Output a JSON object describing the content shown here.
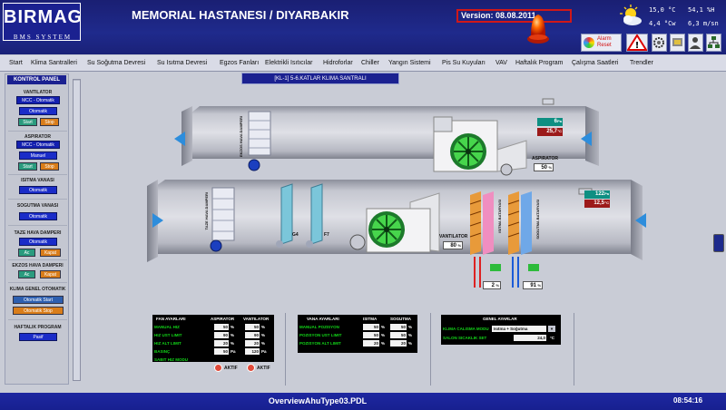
{
  "header": {
    "logo_text": "BIRMAG",
    "logo_sub": "BMS SYSTEM",
    "title": "MEMORIAL HASTANESI / DIYARBAKIR",
    "version": "Version: 08.08.2011",
    "alarm_reset": "Alarm Reset",
    "weather": {
      "temp": "15,0 °C",
      "hum": "54,1 %H",
      "enthalpy": "4,4 °Cw",
      "wind": "6,3 m/sn"
    }
  },
  "menu": [
    "Start",
    "Klima Santralleri",
    "Su Soğutma Devresi",
    "Su Isıtma Devresi",
    "Egzos Fanları",
    "Elektrikli Isıtıcılar",
    "Hidroforlar",
    "Chiller",
    "Yangın Sistemi",
    "Pis Su Kuyuları",
    "VAV",
    "Haftalık Program",
    "Çalışma Saatleri",
    "Trendler"
  ],
  "panel": {
    "title": "KONTROL PANEL",
    "vantilator_title": "VANTILATOR",
    "vantilator_mode": "MCC - Otomatik",
    "vantilator_state": "Otomatik",
    "aspirator_title": "ASPIRATOR",
    "aspirator_mode": "MCC - Otomatik",
    "aspirator_state": "Manuel",
    "start": "Start",
    "stop": "Stop",
    "isitma_title": "ISITMA VANASI",
    "isitma_state": "Otomatik",
    "sogutma_title": "SOGUTMA VANASI",
    "sogutma_state": "Otomatik",
    "taze_title": "TAZE HAVA DAMPERI",
    "taze_state": "Otomatik",
    "egzos_title": "EKZOS HAVA DAMPERI",
    "ac": "Ac",
    "kapat": "Kapat",
    "klima_title": "KLIMA GENEL OTOMATIK",
    "klima_start": "Otomatik Start",
    "klima_stop": "Otomatik Stop",
    "haftalik_title": "HAFTALIK PROGRAM",
    "haftalik_state": "Pasif"
  },
  "sheet_title": "[KL-1] 5-6.KATLAR KLIMA SANTRALI",
  "diagram": {
    "upper_pressure": "6",
    "upper_pressure_unit": "Pa",
    "upper_temp": "25,7",
    "upper_temp_unit": "°C",
    "aspirator_label": "ASPIRATOR",
    "aspirator_speed": "50",
    "aspirator_unit": "%",
    "lower_pressure": "122",
    "lower_pressure_unit": "Pa",
    "lower_temp": "12,5",
    "lower_temp_unit": "°C",
    "vantilator_label": "VANTILATOR",
    "vantilator_speed": "80",
    "vantilator_unit": "%",
    "heating_valve": "2",
    "cooling_valve": "91",
    "valve_unit": "%",
    "filter1": "G4",
    "filter2": "F7",
    "exhaust_damper_label": "EKZOS HAVA DAMPERI",
    "fresh_damper_label": "TAZE HAVA DAMPERI",
    "heating_coil_label": "ISITMA BATARYASI",
    "cooling_coil_label": "SOGUTMA BATARYASI"
  },
  "fan_table": {
    "headers": [
      "FAN AYARLARI",
      "ASPIRATOR",
      "VANTILATOR"
    ],
    "rows": [
      {
        "label": "MANUAL HIZ",
        "a": "50",
        "au": "%",
        "v": "50",
        "vu": "%"
      },
      {
        "label": "HIZ UST LIMIT",
        "a": "90",
        "au": "%",
        "v": "90",
        "vu": "%"
      },
      {
        "label": "HIZ ALT LIMIT",
        "a": "20",
        "au": "%",
        "v": "20",
        "vu": "%"
      },
      {
        "label": "BASINÇ",
        "a": "50",
        "au": "Pa",
        "v": "120",
        "vu": "Pa"
      }
    ],
    "sabit_label": "SABIT HIZ MODU",
    "aktif1": "AKTIF",
    "aktif2": "AKTIF"
  },
  "valve_table": {
    "headers": [
      "VANA AYARLARI",
      "ISITMA",
      "SOGUTMA"
    ],
    "rows": [
      {
        "label": "MANUAL POZISYON",
        "i": "50",
        "iu": "%",
        "s": "50",
        "su": "%"
      },
      {
        "label": "POZISYON UST LIMIT",
        "i": "50",
        "iu": "%",
        "s": "50",
        "su": "%"
      },
      {
        "label": "POZISYON ALT LIMIT",
        "i": "20",
        "iu": "%",
        "s": "20",
        "su": "%"
      }
    ]
  },
  "general_table": {
    "header": "GENEL AYARLAR",
    "mode_label": "KLIMA CALISMA MODU",
    "mode_value": "Isıtma + Soğutma",
    "setpoint_label": "SALON SICAKLIK SET",
    "setpoint_value": "24,0",
    "setpoint_unit": "°C"
  },
  "statusbar": {
    "filename": "OverviewAhuType03.PDL",
    "clock": "08:54:16"
  }
}
